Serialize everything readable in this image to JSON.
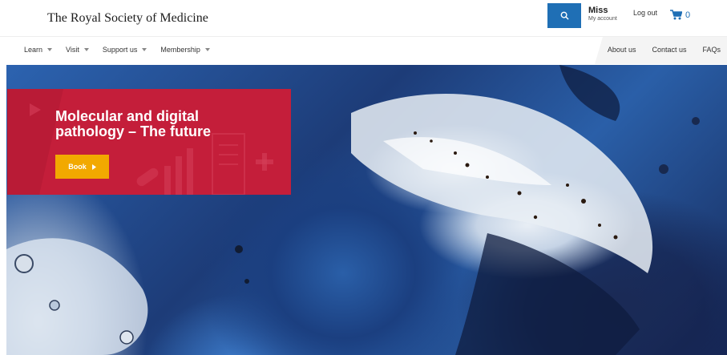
{
  "header": {
    "logo_text": "The Royal Society of Medicine",
    "account_name": "Miss",
    "account_sub": "My account",
    "logout_label": "Log out",
    "cart_count": "0"
  },
  "nav": {
    "items": [
      {
        "label": "Learn"
      },
      {
        "label": "Visit"
      },
      {
        "label": "Support us"
      },
      {
        "label": "Membership"
      }
    ],
    "secondary": [
      {
        "label": "About us"
      },
      {
        "label": "Contact us"
      },
      {
        "label": "FAQs"
      }
    ]
  },
  "hero": {
    "title": "Molecular and digital pathology – The future",
    "cta_label": "Book"
  },
  "colors": {
    "primary_blue": "#1f6fb5",
    "banner_red": "#c41e3a",
    "cta_amber": "#f2a900"
  }
}
